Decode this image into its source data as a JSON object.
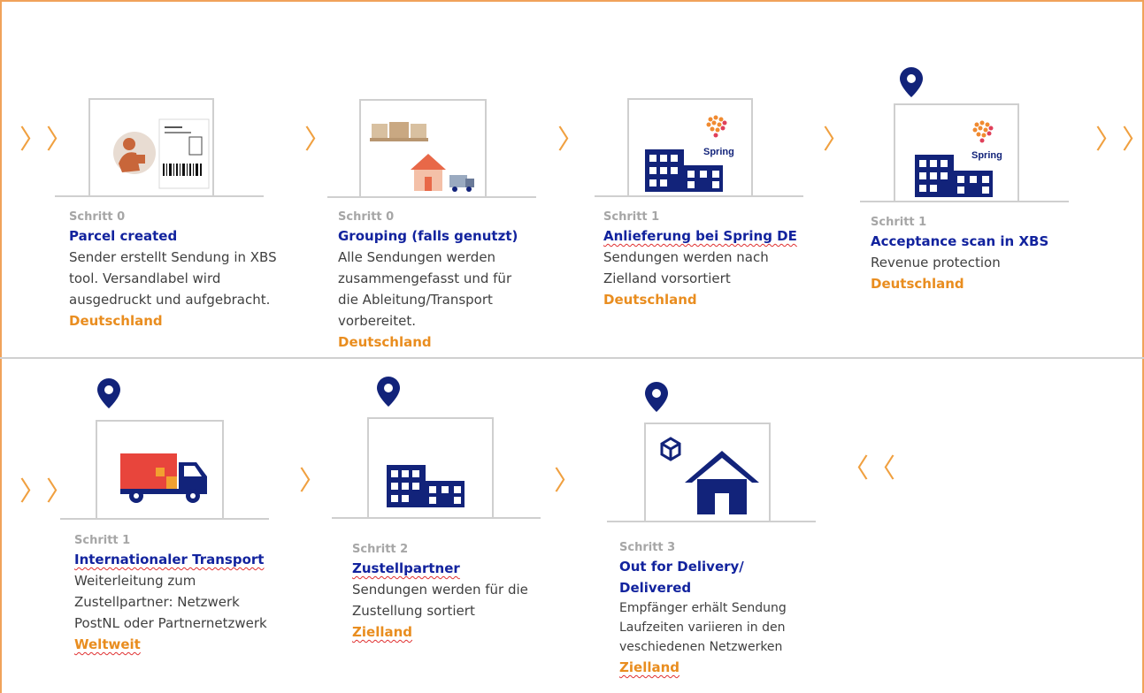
{
  "colors": {
    "title": "#12239e",
    "location": "#e98d1f",
    "arrow": "#f0a040",
    "step": "#a6a6a6",
    "navy": "#12237a"
  },
  "arrows": {
    "double_right": "〉〉",
    "single_right": "〉",
    "double_left": "〈〈"
  },
  "steps": [
    {
      "step": "Schritt 0",
      "title": [
        "Parcel created"
      ],
      "desc": [
        "Sender erstellt Sendung in XBS",
        "tool. Versandlabel wird",
        "ausgedruckt und aufgebracht."
      ],
      "location": "Deutschland",
      "icon": "parcel-label-icon",
      "pin": false
    },
    {
      "step": "Schritt 0",
      "title": [
        "Grouping (falls genutzt)"
      ],
      "desc": [
        "Alle Sendungen werden",
        "zusammengefasst und für",
        "die Ableitung/Transport",
        "vorbereitet."
      ],
      "location": "Deutschland",
      "icon": "grouping-icon",
      "pin": false
    },
    {
      "step": "Schritt 1",
      "title": [
        "Anlieferung bei Spring DE"
      ],
      "desc": [
        "Sendungen werden nach",
        "Zielland vorsortiert"
      ],
      "location": "Deutschland",
      "icon": "spring-warehouse-icon",
      "pin": false
    },
    {
      "step": "Schritt 1",
      "title": [
        "Acceptance scan in XBS"
      ],
      "desc": [
        "Revenue protection"
      ],
      "location": "Deutschland",
      "icon": "spring-warehouse-icon",
      "pin": true
    },
    {
      "step": "Schritt 1",
      "title": [
        "Internationaler Transport"
      ],
      "desc": [
        "Weiterleitung zum",
        "Zustellpartner: Netzwerk",
        "PostNL oder Partnernetzwerk"
      ],
      "location": "Weltweit",
      "icon": "truck-icon",
      "pin": true
    },
    {
      "step": "Schritt 2",
      "title": [
        "Zustellpartner"
      ],
      "desc": [
        "Sendungen werden für die",
        "Zustellung sortiert"
      ],
      "location": "Zielland",
      "icon": "warehouse-icon",
      "pin": true
    },
    {
      "step": "Schritt 3",
      "title": [
        "Out for Delivery/",
        "Delivered"
      ],
      "desc": [
        "Empfänger erhält Sendung",
        "Laufzeiten variieren in den",
        "veschiedenen Netzwerken"
      ],
      "location": "Zielland",
      "icon": "house-package-icon",
      "pin": true
    }
  ],
  "brand": {
    "spring_label": "Spring"
  }
}
